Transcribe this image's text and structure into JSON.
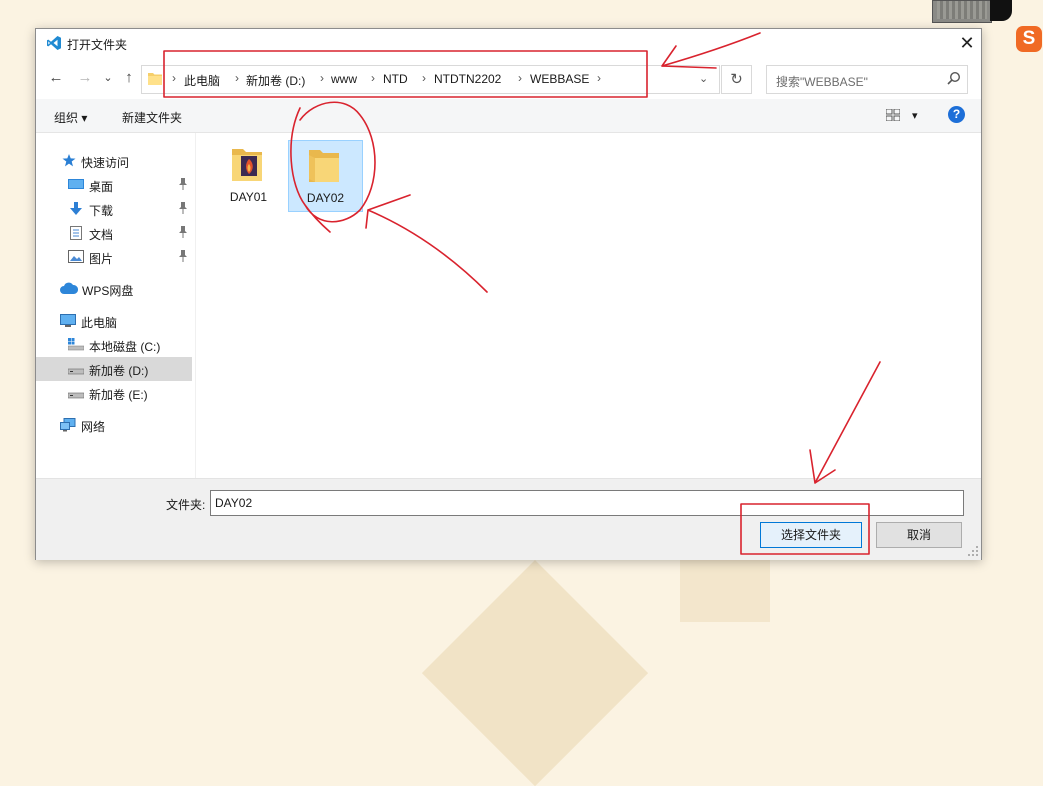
{
  "window": {
    "title": "打开文件夹",
    "close_glyph": "✕"
  },
  "nav": {
    "back_glyph": "←",
    "forward_glyph": "→",
    "recent_glyph": "⌄",
    "up_glyph": "↑",
    "breadcrumbs": [
      "此电脑",
      "新加卷 (D:)",
      "www",
      "NTD",
      "NTDTN2202",
      "WEBBASE"
    ],
    "separator": "›",
    "dropdown_glyph": "⌄",
    "refresh_glyph": "↻",
    "search_placeholder": "搜索\"WEBBASE\""
  },
  "toolbar": {
    "organize": "组织 ▾",
    "new_folder": "新建文件夹",
    "view_dropdown": "▾",
    "help": "?"
  },
  "sidebar": {
    "quick_access": "快速访问",
    "quick_items": [
      "桌面",
      "下载",
      "文档",
      "图片"
    ],
    "wps": "WPS网盘",
    "this_pc": "此电脑",
    "drives": [
      "本地磁盘 (C:)",
      "新加卷 (D:)",
      "新加卷 (E:)"
    ],
    "network": "网络",
    "selected": "新加卷 (D:)"
  },
  "files": [
    {
      "name": "DAY01",
      "selected": false
    },
    {
      "name": "DAY02",
      "selected": true
    }
  ],
  "footer": {
    "folder_label": "文件夹:",
    "folder_value": "DAY02",
    "select_button": "选择文件夹",
    "cancel_button": "取消"
  },
  "overlay": {
    "ime_logo": "S"
  },
  "colors": {
    "accent": "#0078d7",
    "annotation": "#d9232e",
    "selection": "#cce8ff",
    "background": "#fbf3e2"
  }
}
